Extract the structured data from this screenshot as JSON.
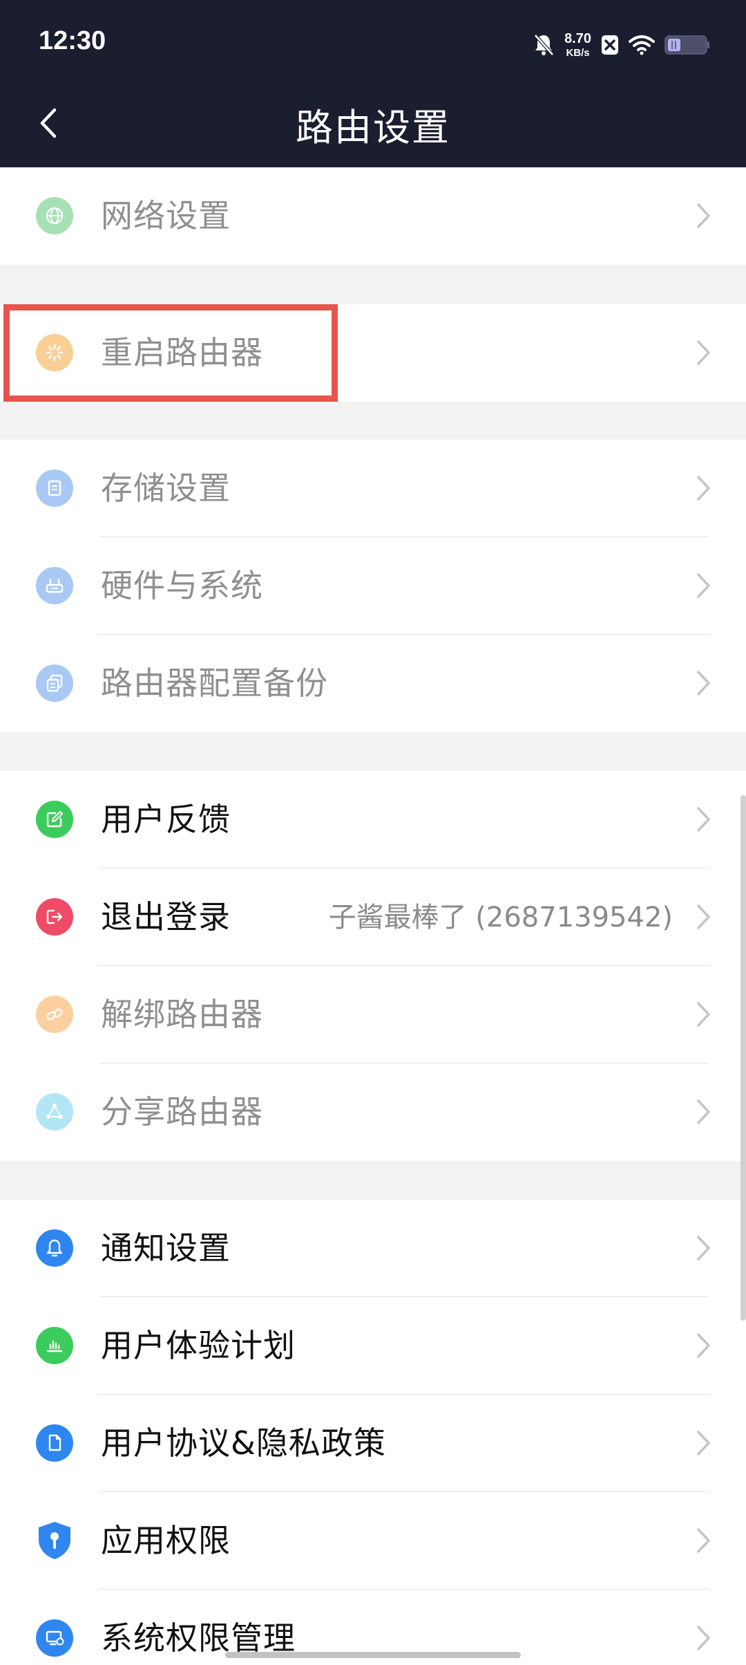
{
  "status_bar": {
    "time": "12:30",
    "net_speed_value": "8.70",
    "net_speed_unit": "KB/s",
    "icons": [
      "bell-off-icon",
      "close-box-icon",
      "wifi-icon",
      "battery-icon"
    ]
  },
  "nav": {
    "title": "路由设置",
    "back_icon": "back-arrow-icon"
  },
  "sections": [
    {
      "items": [
        {
          "label": "网络设置",
          "icon": "globe-icon",
          "icon_color": "#a8e0b6",
          "enabled": false
        }
      ]
    },
    {
      "items": [
        {
          "label": "重启路由器",
          "icon": "restart-spinner-icon",
          "icon_color": "#f9cf96",
          "enabled": false
        }
      ]
    },
    {
      "items": [
        {
          "label": "存储设置",
          "icon": "storage-icon",
          "icon_color": "#a9c9f4",
          "enabled": false
        },
        {
          "label": "硬件与系统",
          "icon": "router-hardware-icon",
          "icon_color": "#a9c9f4",
          "enabled": false
        },
        {
          "label": "路由器配置备份",
          "icon": "backup-copy-icon",
          "icon_color": "#a9c9f4",
          "enabled": false
        }
      ]
    },
    {
      "items": [
        {
          "label": "用户反馈",
          "icon": "feedback-edit-icon",
          "icon_color": "#3ccc5c",
          "enabled": true
        },
        {
          "label": "退出登录",
          "icon": "logout-icon",
          "icon_color": "#ef4b67",
          "enabled": true,
          "value": "子酱最棒了 (2687139542)"
        },
        {
          "label": "解绑路由器",
          "icon": "unlink-icon",
          "icon_color": "#fbcfa0",
          "enabled": false
        },
        {
          "label": "分享路由器",
          "icon": "share-icon",
          "icon_color": "#b2e6f5",
          "enabled": false
        }
      ]
    },
    {
      "items": [
        {
          "label": "通知设置",
          "icon": "bell-icon",
          "icon_color": "#2f86ef",
          "enabled": true
        },
        {
          "label": "用户体验计划",
          "icon": "chart-bars-icon",
          "icon_color": "#3ccc5c",
          "enabled": true
        },
        {
          "label": "用户协议&隐私政策",
          "icon": "document-icon",
          "icon_color": "#2f86ef",
          "enabled": true
        },
        {
          "label": "应用权限",
          "icon": "shield-key-icon",
          "icon_color": "#2f86ef",
          "enabled": true
        },
        {
          "label": "系统权限管理",
          "icon": "monitor-settings-icon",
          "icon_color": "#2f86ef",
          "enabled": true
        }
      ]
    }
  ],
  "colors": {
    "header_bg": "#1b1e2f",
    "page_bg": "#f2f2f3",
    "highlight": "#e8534d"
  }
}
